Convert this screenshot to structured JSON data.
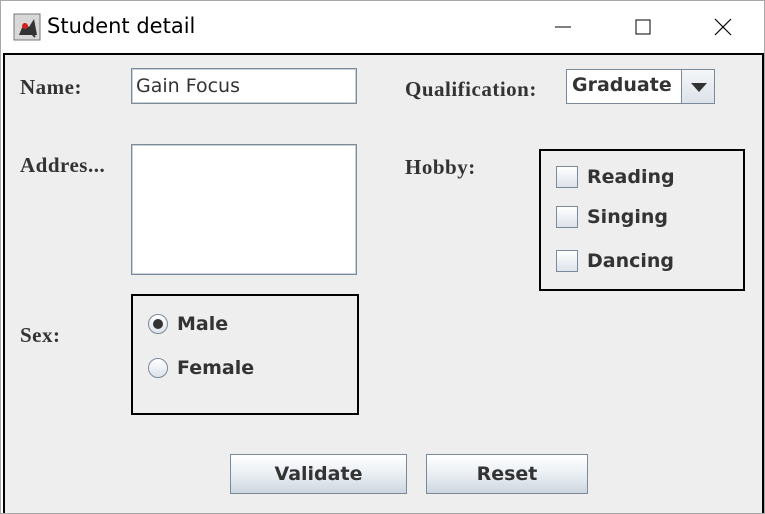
{
  "window": {
    "title": "Student detail",
    "app_icon": "java-duke-icon",
    "controls": [
      "minimize-icon",
      "maximize-icon",
      "close-icon"
    ]
  },
  "form": {
    "name_label": "Name:",
    "name_value": "Gain Focus",
    "address_label": "Addres...",
    "address_value": "",
    "sex_label": "Sex:",
    "sex_options": [
      {
        "label": "Male",
        "selected": true
      },
      {
        "label": "Female",
        "selected": false
      }
    ],
    "qualification_label": "Qualification:",
    "qualification_value": "Graduate",
    "hobby_label": "Hobby:",
    "hobby_options": [
      {
        "label": "Reading",
        "checked": false
      },
      {
        "label": "Singing",
        "checked": false
      },
      {
        "label": "Dancing",
        "checked": false
      }
    ]
  },
  "buttons": {
    "validate": "Validate",
    "reset": "Reset"
  }
}
